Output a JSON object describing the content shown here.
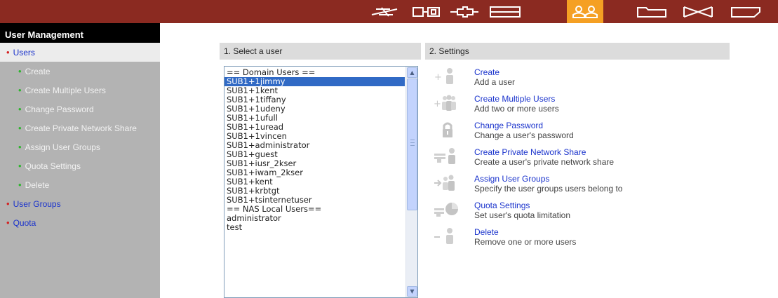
{
  "topnav": {
    "items": [
      {
        "icon": "network-icon",
        "active": false
      },
      {
        "icon": "server-icon",
        "active": false
      },
      {
        "icon": "device-connect-icon",
        "active": false
      },
      {
        "icon": "disk-icon",
        "active": false
      },
      {
        "icon": "users-icon",
        "active": true
      },
      {
        "icon": "folder-icon",
        "active": false
      },
      {
        "icon": "tools-icon",
        "active": false
      },
      {
        "icon": "status-icon",
        "active": false
      }
    ],
    "active_color": "#f5a023",
    "bar_color": "#8b2a21"
  },
  "sidebar": {
    "title": "User Management",
    "items": [
      {
        "label": "Users",
        "level": "top",
        "active": true
      },
      {
        "label": "Create",
        "level": "sub"
      },
      {
        "label": "Create Multiple Users",
        "level": "sub"
      },
      {
        "label": "Change Password",
        "level": "sub"
      },
      {
        "label": "Create Private Network Share",
        "level": "sub"
      },
      {
        "label": "Assign User Groups",
        "level": "sub"
      },
      {
        "label": "Quota Settings",
        "level": "sub"
      },
      {
        "label": "Delete",
        "level": "sub"
      },
      {
        "label": "User Groups",
        "level": "top"
      },
      {
        "label": "Quota",
        "level": "top"
      }
    ]
  },
  "select_user": {
    "heading": "1. Select a user",
    "items": [
      "== Domain Users ==",
      "SUB1+1jimmy",
      "SUB1+1kent",
      "SUB1+1tiffany",
      "SUB1+1udeny",
      "SUB1+1ufull",
      "SUB1+1uread",
      "SUB1+1vincen",
      "SUB1+administrator",
      "SUB1+guest",
      "SUB1+iusr_2kser",
      "SUB1+iwam_2kser",
      "SUB1+kent",
      "SUB1+krbtgt",
      "SUB1+tsinternetuser",
      "== NAS Local Users==",
      "administrator",
      "test"
    ],
    "selected": "SUB1+1jimmy"
  },
  "settings": {
    "heading": "2. Settings",
    "items": [
      {
        "title": "Create",
        "desc": "Add a user",
        "icon": "add-user-icon"
      },
      {
        "title": "Create Multiple Users",
        "desc": "Add two or more users",
        "icon": "add-multiple-users-icon"
      },
      {
        "title": "Change Password",
        "desc": "Change a user's password",
        "icon": "padlock-icon"
      },
      {
        "title": "Create Private Network Share",
        "desc": "Create a user's private network share",
        "icon": "private-share-icon"
      },
      {
        "title": "Assign User Groups",
        "desc": "Specify the user groups users belong to",
        "icon": "assign-groups-icon"
      },
      {
        "title": "Quota Settings",
        "desc": "Set user's quota limitation",
        "icon": "quota-pie-icon"
      },
      {
        "title": "Delete",
        "desc": "Remove one or more users",
        "icon": "remove-user-icon"
      }
    ]
  }
}
